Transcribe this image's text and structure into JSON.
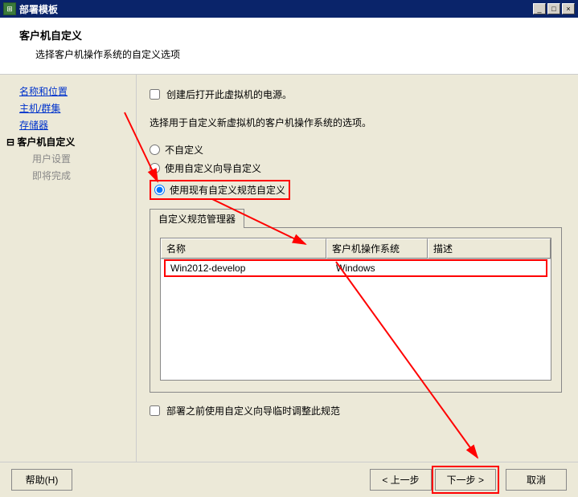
{
  "window": {
    "title": "部署模板",
    "minimize": "_",
    "maximize": "□",
    "close": "×"
  },
  "header": {
    "title": "客户机自定义",
    "subtitle": "选择客户机操作系统的自定义选项"
  },
  "sidebar": {
    "items": [
      {
        "label": "名称和位置",
        "link": true
      },
      {
        "label": "主机/群集",
        "link": true
      },
      {
        "label": "存储器",
        "link": true
      }
    ],
    "current": "客户机自定义",
    "subs": [
      {
        "label": "用户设置"
      },
      {
        "label": "即将完成"
      }
    ]
  },
  "main": {
    "poweron_label": "创建后打开此虚拟机的电源。",
    "select_label": "选择用于自定义新虚拟机的客户机操作系统的选项。",
    "radio_none": "不自定义",
    "radio_wizard": "使用自定义向导自定义",
    "radio_existing": "使用现有自定义规范自定义",
    "tab_label": "自定义规范管理器",
    "cols": {
      "name": "名称",
      "os": "客户机操作系统",
      "desc": "描述"
    },
    "rows": [
      {
        "name": "Win2012-develop",
        "os": "Windows",
        "desc": ""
      }
    ],
    "adjust_label": "部署之前使用自定义向导临时调整此规范"
  },
  "footer": {
    "help": "帮助(H)",
    "prev": "< 上一步",
    "next": "下一步 >",
    "cancel": "取消"
  }
}
